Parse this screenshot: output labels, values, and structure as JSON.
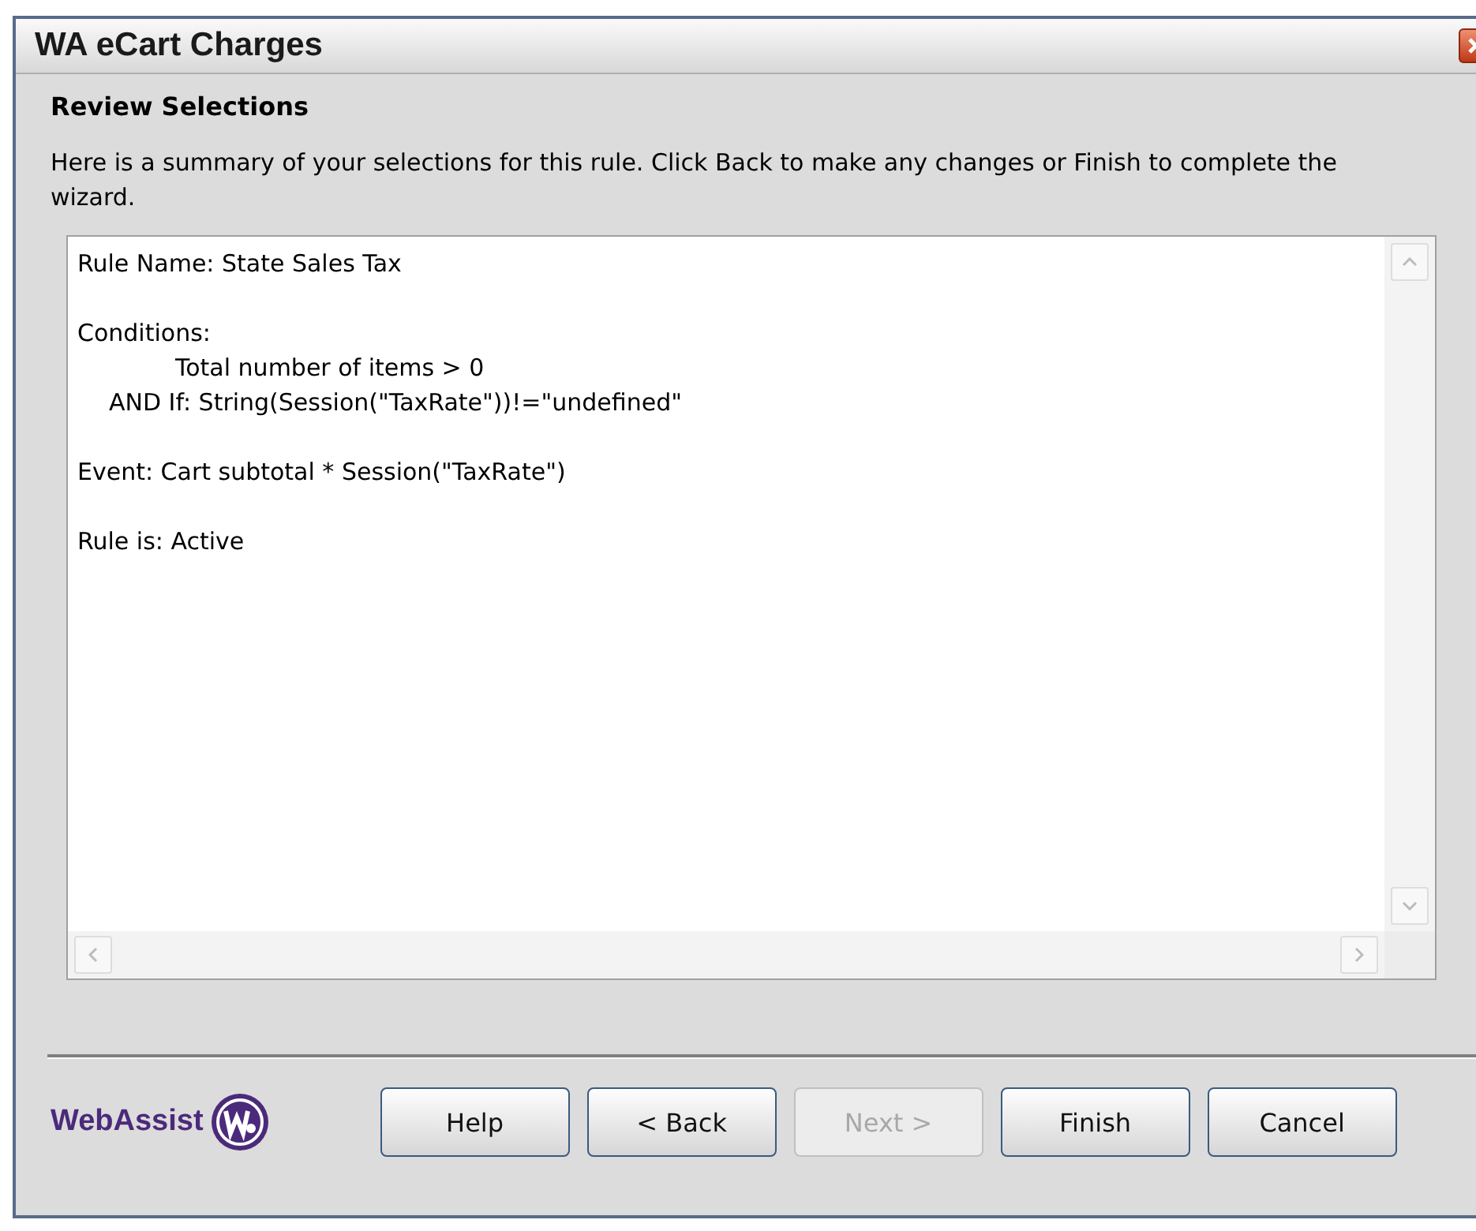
{
  "window": {
    "title": "WA eCart Charges"
  },
  "heading": "Review Selections",
  "description": "Here is a summary of your selections for this rule. Click Back to make any changes or Finish to complete the wizard.",
  "summary": {
    "blocks": [
      {
        "lines": [
          {
            "kind": "plain",
            "text": "Rule Name: State Sales Tax"
          }
        ]
      },
      {
        "lines": [
          {
            "kind": "plain",
            "text": "Conditions:"
          },
          {
            "kind": "condition",
            "text": "Total number of items > 0"
          },
          {
            "kind": "connector",
            "text": "AND If: String(Session(\"TaxRate\"))!=\"undefined\""
          }
        ]
      },
      {
        "lines": [
          {
            "kind": "plain",
            "text": "Event: Cart subtotal * Session(\"TaxRate\")"
          }
        ]
      },
      {
        "lines": [
          {
            "kind": "plain",
            "text": "Rule is: Active"
          }
        ]
      }
    ]
  },
  "logo": {
    "text": "WebAssist"
  },
  "buttons": [
    {
      "label": "Help",
      "disabled": false
    },
    {
      "label": "< Back",
      "disabled": false
    },
    {
      "label": "Next >",
      "disabled": true
    },
    {
      "label": "Finish",
      "disabled": false
    },
    {
      "label": "Cancel",
      "disabled": false
    }
  ]
}
